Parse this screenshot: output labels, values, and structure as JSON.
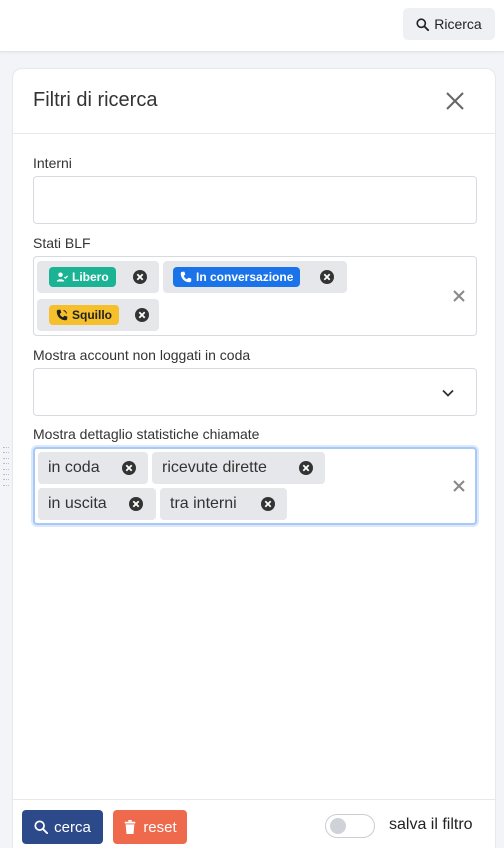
{
  "topbar": {
    "search_button_label": "Ricerca",
    "search_icon": "magnifier-icon"
  },
  "panel": {
    "title": "Filtri di ricerca",
    "close_icon": "close-icon"
  },
  "fields": {
    "interni": {
      "label": "Interni",
      "value": ""
    },
    "stati_blf": {
      "label": "Stati BLF",
      "tags": [
        {
          "label": "Libero",
          "icon": "user-check-icon",
          "color": "#1ab394"
        },
        {
          "label": "In conversazione",
          "icon": "phone-icon",
          "color": "#1a73e8"
        },
        {
          "label": "Squillo",
          "icon": "phone-ringing-icon",
          "color": "#f5c02c"
        }
      ]
    },
    "account_non_loggati": {
      "label": "Mostra account non loggati in coda",
      "value": ""
    },
    "dettaglio_statistiche": {
      "label": "Mostra dettaglio statistiche chiamate",
      "tags": [
        "in coda",
        "ricevute dirette",
        "in uscita",
        "tra interni"
      ]
    }
  },
  "footer": {
    "search_label": "cerca",
    "reset_label": "reset",
    "save_filter_label": "salva il filtro",
    "save_filter_enabled": false,
    "search_color": "#2c4a8a",
    "reset_color": "#ef6a4c"
  }
}
